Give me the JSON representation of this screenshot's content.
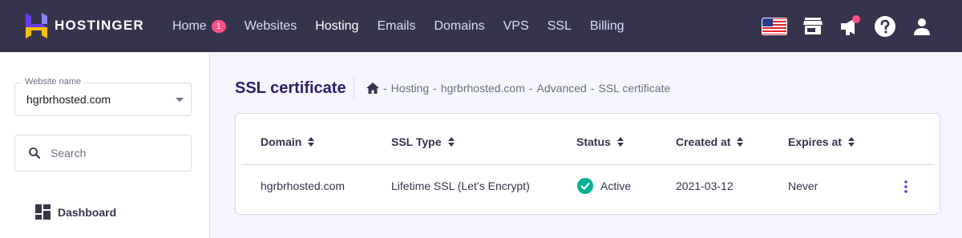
{
  "brand": {
    "name": "HOSTINGER",
    "logo_icon": "hostinger-logo",
    "accent": "#673de6",
    "header_bg": "#36344d"
  },
  "nav": [
    {
      "label": "Home",
      "badge": "1"
    },
    {
      "label": "Websites"
    },
    {
      "label": "Hosting",
      "active": true
    },
    {
      "label": "Emails"
    },
    {
      "label": "Domains"
    },
    {
      "label": "VPS"
    },
    {
      "label": "SSL"
    },
    {
      "label": "Billing"
    }
  ],
  "top_icons": [
    "us-flag-icon",
    "store-icon",
    "megaphone-icon",
    "help-icon",
    "user-icon"
  ],
  "sidebar": {
    "website_label": "Website name",
    "website_value": "hgrbrhosted.com",
    "search_placeholder": "Search",
    "items": [
      {
        "label": "Dashboard",
        "icon": "dashboard-icon"
      }
    ]
  },
  "page": {
    "title": "SSL certificate",
    "breadcrumb": [
      "Hosting",
      "hgrbrhosted.com",
      "Advanced",
      "SSL certificate"
    ],
    "breadcrumb_separator": "-"
  },
  "table": {
    "columns": [
      "Domain",
      "SSL Type",
      "Status",
      "Created at",
      "Expires at"
    ],
    "rows": [
      {
        "domain": "hgrbrhosted.com",
        "ssl_type": "Lifetime SSL (Let’s Encrypt)",
        "status": "Active",
        "status_color": "#00b090",
        "created_at": "2021-03-12",
        "expires_at": "Never"
      }
    ]
  }
}
